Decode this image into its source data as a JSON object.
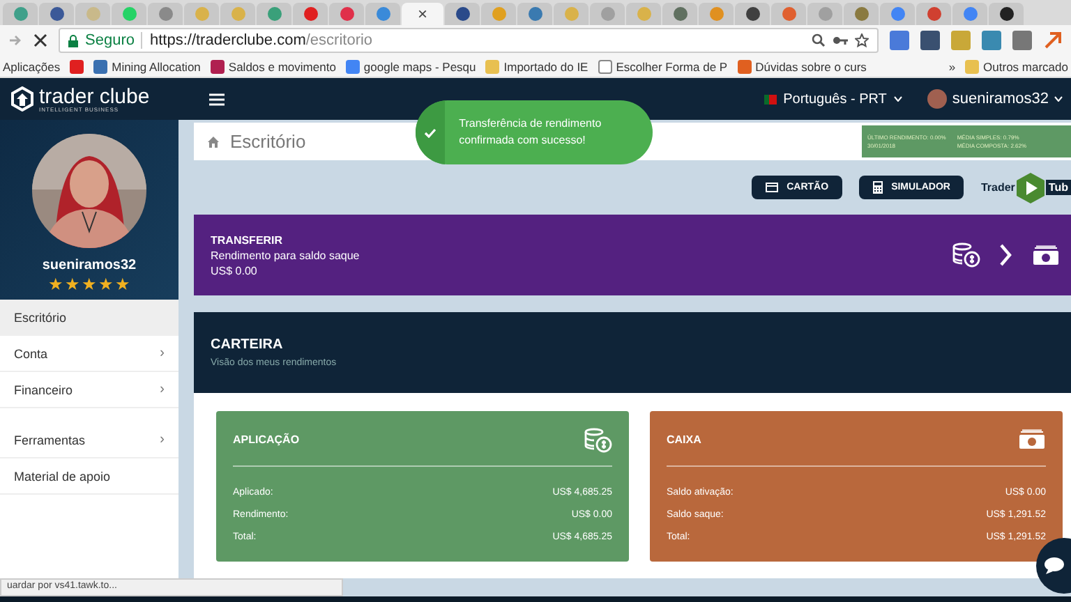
{
  "browser": {
    "tabs": [
      {
        "color": "#3fa08a",
        "selected": false
      },
      {
        "color": "#3b5998",
        "selected": false
      },
      {
        "color": "#c9b98a",
        "selected": false
      },
      {
        "color": "#25d366",
        "selected": false
      },
      {
        "color": "#8a8a8a",
        "selected": false
      },
      {
        "color": "#d9b24a",
        "selected": false
      },
      {
        "color": "#d9b24a",
        "selected": false
      },
      {
        "color": "#3aa07a",
        "selected": false
      },
      {
        "color": "#e02020",
        "selected": false
      },
      {
        "color": "#e0304a",
        "selected": false
      },
      {
        "color": "#3a8ad9",
        "selected": false
      },
      {
        "selected": true
      },
      {
        "color": "#2a4a8a",
        "selected": false
      },
      {
        "color": "#e0a020",
        "selected": false
      },
      {
        "color": "#3a7ab0",
        "selected": false
      },
      {
        "color": "#d9b24a",
        "selected": false
      },
      {
        "color": "#a0a0a0",
        "selected": false
      },
      {
        "color": "#d9b24a",
        "selected": false
      },
      {
        "color": "#607060",
        "selected": false
      },
      {
        "color": "#e09020",
        "selected": false
      },
      {
        "color": "#404040",
        "selected": false
      },
      {
        "color": "#e06030",
        "selected": false
      },
      {
        "color": "#a0a0a0",
        "selected": false
      },
      {
        "color": "#8a7a40",
        "selected": false
      },
      {
        "color": "#4285f4",
        "selected": false
      },
      {
        "color": "#d04030",
        "selected": false
      },
      {
        "color": "#4285f4",
        "selected": false
      },
      {
        "color": "#222222",
        "selected": false
      }
    ],
    "close_glyph": "×",
    "secure_label": "Seguro",
    "url_host": "https://traderclube.com",
    "url_path": "/escritorio",
    "bookmarks": [
      {
        "label": "Aplicações",
        "kind": "apps"
      },
      {
        "kind": "youtube"
      },
      {
        "label": "Mining Allocation",
        "kind": "grid"
      },
      {
        "label": "Saldos e movimento",
        "kind": "m"
      },
      {
        "label": "google maps - Pesqu",
        "kind": "google"
      },
      {
        "label": "Importado do IE",
        "kind": "folder"
      },
      {
        "label": "Escolher Forma de P",
        "kind": "page"
      },
      {
        "label": "Dúvidas sobre o curs",
        "kind": "orange"
      }
    ],
    "more_glyph": "»",
    "other_bookmarks": "Outros marcado",
    "status_text": "uardar por vs41.tawk.to..."
  },
  "header": {
    "logo_name": "trader clube",
    "logo_tagline": "INTELLIGENT BUSINESS",
    "language": "Português - PRT",
    "user": "sueniramos32"
  },
  "toast": {
    "message": "Transferência de rendimento confirmada com sucesso!"
  },
  "profile": {
    "name": "sueniramos32",
    "stars": 5
  },
  "sidebar": {
    "items": [
      {
        "label": "Escritório",
        "selected": true,
        "has_submenu": false
      },
      {
        "label": "Conta",
        "selected": false,
        "has_submenu": true
      },
      {
        "label": "Financeiro",
        "selected": false,
        "has_submenu": true
      },
      {
        "label": "Ferramentas",
        "selected": false,
        "has_submenu": true
      },
      {
        "label": "Material de apoio",
        "selected": false,
        "has_submenu": false
      }
    ],
    "chevron": "›"
  },
  "breadcrumb": "Escritório",
  "stats": [
    {
      "line1": "ÚLTIMO RENDIMENTO: 0.00%",
      "line2": "30/01/2018"
    },
    {
      "line1": "MÉDIA SIMPLES: 0.79%",
      "line2": "MÉDIA COMPOSTA: 2.62%"
    }
  ],
  "actions": [
    {
      "label": "CARTÃO",
      "kind": "card"
    },
    {
      "label": "SIMULADOR",
      "kind": "calculator"
    }
  ],
  "tube": {
    "left": "Trader",
    "right": "Tub"
  },
  "transfer": {
    "title": "TRANSFERIR",
    "subtitle": "Rendimento para saldo saque",
    "amount": "US$ 0.00"
  },
  "wallet": {
    "title": "CARTEIRA",
    "subtitle": "Visão dos meus rendimentos",
    "cards": [
      {
        "title": "APLICAÇÃO",
        "kind": "coins",
        "color": "#5e9964",
        "rows": [
          {
            "label": "Aplicado:",
            "value": "US$ 4,685.25"
          },
          {
            "label": "Rendimento:",
            "value": "US$ 0.00"
          },
          {
            "label": "Total:",
            "value": "US$ 4,685.25"
          }
        ]
      },
      {
        "title": "CAIXA",
        "kind": "cash",
        "color": "#b9683c",
        "rows": [
          {
            "label": "Saldo ativação:",
            "value": "US$ 0.00"
          },
          {
            "label": "Saldo saque:",
            "value": "US$ 1,291.52"
          },
          {
            "label": "Total:",
            "value": "US$ 1,291.52"
          }
        ]
      }
    ]
  }
}
